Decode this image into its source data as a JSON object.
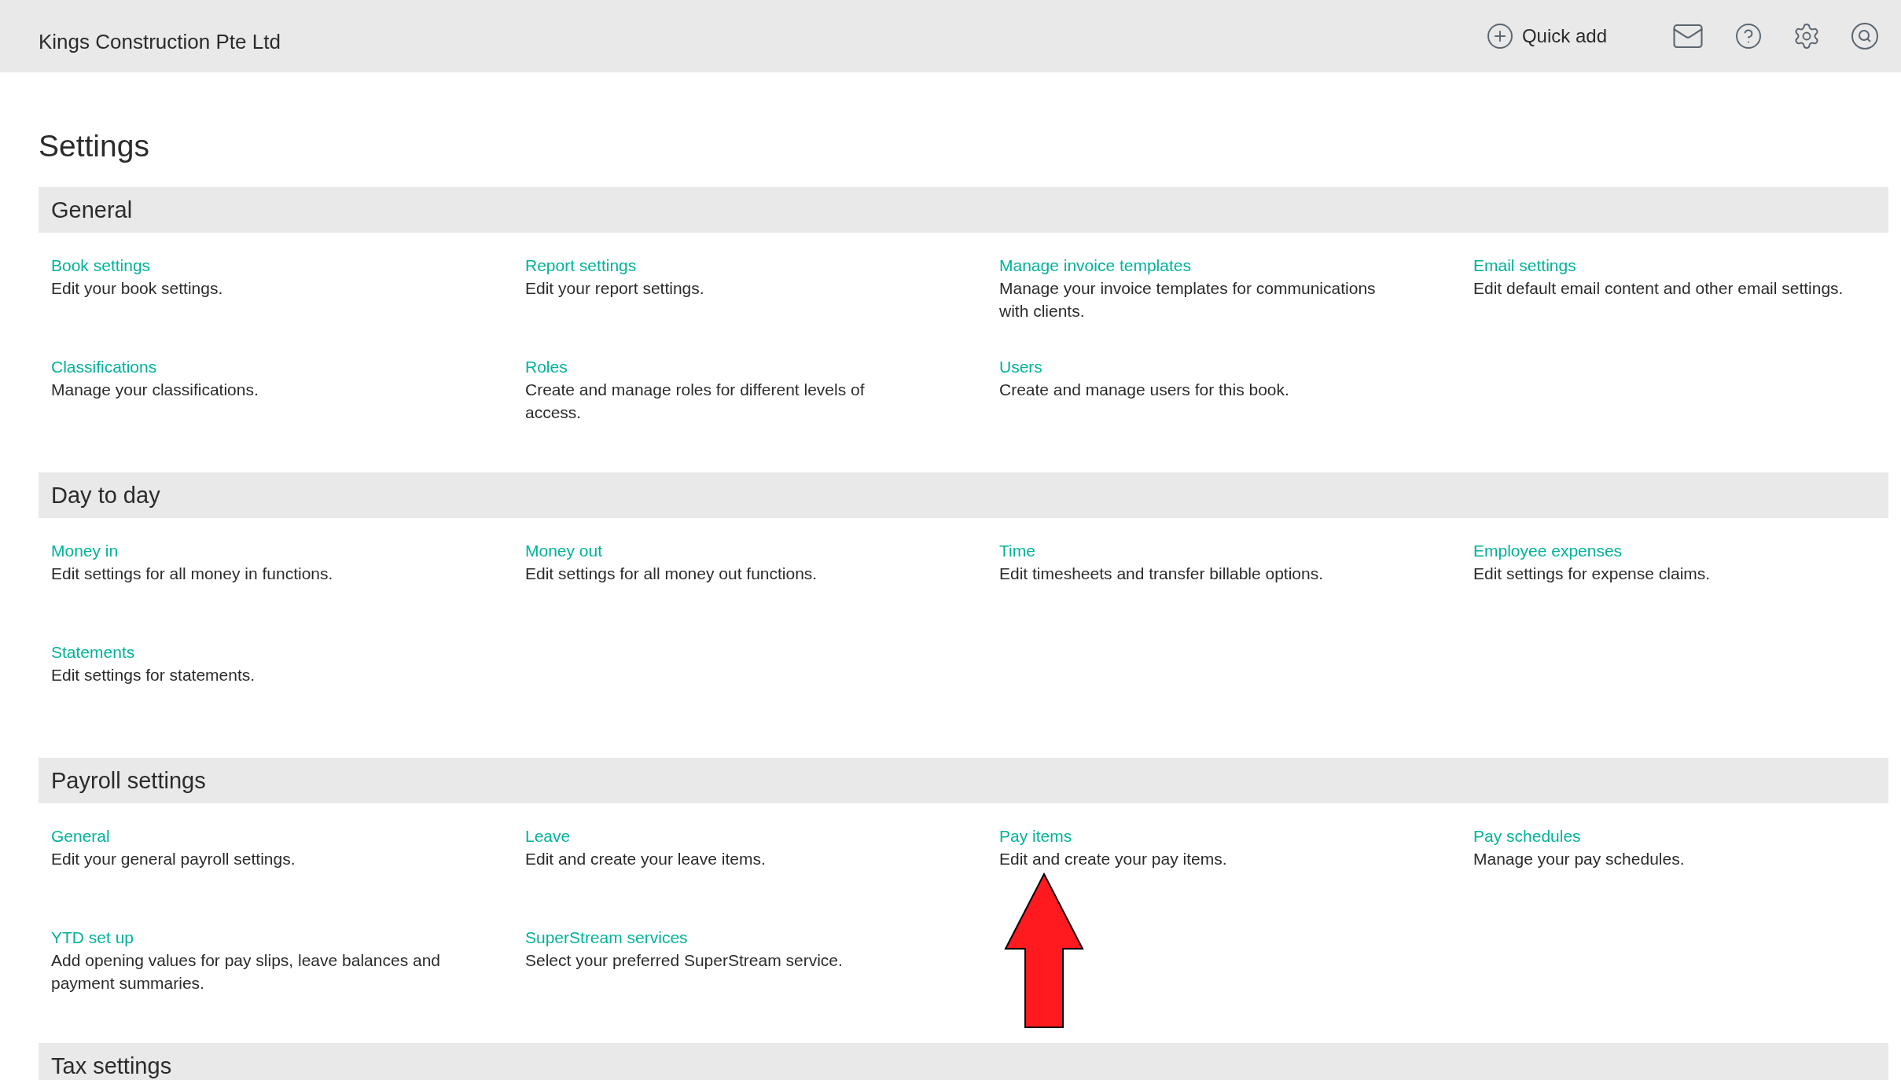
{
  "header": {
    "company": "Kings Construction Pte Ltd",
    "quick_add": "Quick add"
  },
  "page_title": "Settings",
  "sections": [
    {
      "title": "General",
      "items": [
        {
          "link": "Book settings",
          "description": "Edit your book settings."
        },
        {
          "link": "Report settings",
          "description": "Edit your report settings."
        },
        {
          "link": "Manage invoice templates",
          "description": "Manage your invoice templates for communications with clients."
        },
        {
          "link": "Email settings",
          "description": "Edit default email content and other email settings."
        },
        {
          "link": "Classifications",
          "description": "Manage your classifications."
        },
        {
          "link": "Roles",
          "description": "Create and manage roles for different levels of access."
        },
        {
          "link": "Users",
          "description": "Create and manage users for this book."
        }
      ]
    },
    {
      "title": "Day to day",
      "items": [
        {
          "link": "Money in",
          "description": "Edit settings for all money in functions."
        },
        {
          "link": "Money out",
          "description": "Edit settings for all money out functions."
        },
        {
          "link": "Time",
          "description": "Edit timesheets and transfer billable options."
        },
        {
          "link": "Employee expenses",
          "description": "Edit settings for expense claims."
        },
        {
          "link": "Statements",
          "description": "Edit settings for statements."
        }
      ]
    },
    {
      "title": "Payroll settings",
      "items": [
        {
          "link": "General",
          "description": "Edit your general payroll settings."
        },
        {
          "link": "Leave",
          "description": "Edit and create your leave items."
        },
        {
          "link": "Pay items",
          "description": "Edit and create your pay items."
        },
        {
          "link": "Pay schedules",
          "description": "Manage your pay schedules."
        },
        {
          "link": "YTD set up",
          "description": "Add opening values for pay slips, leave balances and payment summaries."
        },
        {
          "link": "SuperStream services",
          "description": "Select your preferred SuperStream service."
        }
      ]
    },
    {
      "title": "Tax settings"
    }
  ]
}
